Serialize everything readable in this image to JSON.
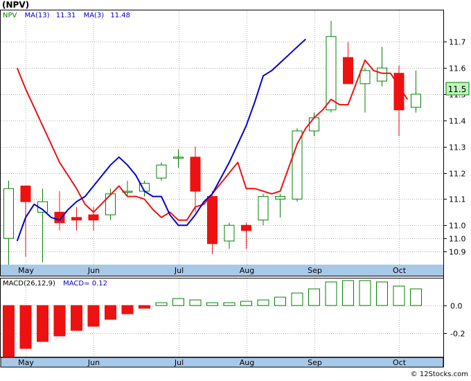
{
  "chart_data": [
    {
      "type": "candlestick",
      "symbol_label": "(NPV)",
      "legend": [
        {
          "text": "NPV",
          "color": "#008000"
        },
        {
          "text": "MA(13)",
          "color": "#0000cc"
        },
        {
          "text": "11.31",
          "color": "#0000cc"
        },
        {
          "text": "MA(3)",
          "color": "#0000cc"
        },
        {
          "text": "11.48",
          "color": "#0000cc"
        }
      ],
      "current_price_label": "11.5",
      "ylim": [
        10.85,
        11.78
      ],
      "yticks": [
        "11.7",
        "11.6",
        "11.5",
        "11.4",
        "11.3",
        "11.2",
        "11.1",
        "11.0",
        "11.0",
        "10.9"
      ],
      "ytick_values": [
        11.7,
        11.6,
        11.5,
        11.4,
        11.3,
        11.2,
        11.1,
        11.0,
        10.95,
        10.9
      ],
      "xticks": [
        "May",
        "Jun",
        "Jul",
        "Aug",
        "Sep",
        "Oct"
      ],
      "xtick_index": [
        1,
        5,
        10,
        14,
        18,
        23
      ],
      "candles": [
        {
          "o": 10.95,
          "h": 11.17,
          "l": 10.85,
          "c": 11.14
        },
        {
          "o": 11.15,
          "h": 11.15,
          "l": 10.88,
          "c": 11.09
        },
        {
          "o": 11.05,
          "h": 11.14,
          "l": 10.86,
          "c": 11.09
        },
        {
          "o": 11.05,
          "h": 11.13,
          "l": 10.98,
          "c": 11.01
        },
        {
          "o": 11.03,
          "h": 11.07,
          "l": 10.98,
          "c": 11.02
        },
        {
          "o": 11.04,
          "h": 11.07,
          "l": 10.98,
          "c": 11.02
        },
        {
          "o": 11.04,
          "h": 11.14,
          "l": 11.02,
          "c": 11.12
        },
        {
          "o": 11.13,
          "h": 11.17,
          "l": 11.11,
          "c": 11.13
        },
        {
          "o": 11.13,
          "h": 11.17,
          "l": 11.11,
          "c": 11.16
        },
        {
          "o": 11.18,
          "h": 11.24,
          "l": 11.17,
          "c": 11.23
        },
        {
          "o": 11.26,
          "h": 11.29,
          "l": 11.22,
          "c": 11.26
        },
        {
          "o": 11.26,
          "h": 11.3,
          "l": 11.05,
          "c": 11.13
        },
        {
          "o": 11.11,
          "h": 11.13,
          "l": 10.89,
          "c": 10.93
        },
        {
          "o": 10.94,
          "h": 11.01,
          "l": 10.91,
          "c": 11.0
        },
        {
          "o": 11.0,
          "h": 11.01,
          "l": 10.91,
          "c": 10.98
        },
        {
          "o": 11.02,
          "h": 11.12,
          "l": 11.0,
          "c": 11.11
        },
        {
          "o": 11.1,
          "h": 11.12,
          "l": 11.03,
          "c": 11.11
        },
        {
          "o": 11.1,
          "h": 11.37,
          "l": 11.09,
          "c": 11.36
        },
        {
          "o": 11.36,
          "h": 11.43,
          "l": 11.34,
          "c": 11.41
        },
        {
          "o": 11.44,
          "h": 11.78,
          "l": 11.43,
          "c": 11.72
        },
        {
          "o": 11.64,
          "h": 11.7,
          "l": 11.54,
          "c": 11.54
        },
        {
          "o": 11.54,
          "h": 11.6,
          "l": 11.43,
          "c": 11.59
        },
        {
          "o": 11.55,
          "h": 11.68,
          "l": 11.53,
          "c": 11.6
        },
        {
          "o": 11.58,
          "h": 11.61,
          "l": 11.34,
          "c": 11.44
        },
        {
          "o": 11.45,
          "h": 11.59,
          "l": 11.43,
          "c": 11.5
        }
      ],
      "series": [
        {
          "name": "MA(3)",
          "color": "#ee1111",
          "values": [
            null,
            11.6,
            11.52,
            11.45,
            11.38,
            11.31,
            11.24,
            11.19,
            11.14,
            11.08,
            11.05,
            null,
            null,
            11.15,
            11.11,
            11.11,
            11.1,
            11.06,
            11.03,
            11.05,
            11.02,
            11.02,
            11.07,
            11.08,
            11.12,
            null,
            null,
            11.24,
            11.14,
            11.14,
            11.13,
            11.12,
            11.13,
            11.22,
            11.31,
            11.37,
            11.41,
            11.44,
            11.48,
            11.46,
            11.46,
            null,
            11.63,
            11.59,
            11.58,
            11.58,
            11.53,
            11.48
          ]
        },
        {
          "name": "MA(13)",
          "color": "#0000cc",
          "values": [
            null,
            10.94,
            11.03,
            11.08,
            11.06,
            11.03,
            11.02,
            11.06,
            11.09,
            11.11,
            11.15,
            11.19,
            11.23,
            11.26,
            11.23,
            11.19,
            11.13,
            11.11,
            11.11,
            11.04,
            11.0,
            11.0,
            11.04,
            11.09,
            11.12,
            11.18,
            11.24,
            11.31,
            11.38,
            11.47,
            11.57,
            11.59,
            11.62,
            11.65,
            11.68,
            11.71,
            null,
            null,
            null,
            null,
            null,
            null,
            null,
            null,
            null,
            null,
            null,
            null
          ]
        }
      ]
    },
    {
      "type": "bar",
      "legend": [
        {
          "text": "MACD(26,12,9)",
          "color": "#000000"
        },
        {
          "text": "MACD=",
          "color": "#0000cc"
        },
        {
          "text": "0.12",
          "color": "#0000cc"
        }
      ],
      "ylim": [
        -0.37,
        0.19
      ],
      "yticks": [
        "0.0",
        "-0.2"
      ],
      "ytick_values": [
        0.0,
        -0.2
      ],
      "xticks": [
        "May",
        "Jun",
        "Jul",
        "Aug",
        "Sep",
        "Oct"
      ],
      "xtick_index": [
        1,
        5,
        10,
        14,
        18,
        23
      ],
      "values": [
        -0.37,
        -0.31,
        -0.26,
        -0.22,
        -0.18,
        -0.15,
        -0.1,
        -0.06,
        -0.02,
        0.02,
        0.05,
        0.04,
        0.02,
        0.02,
        0.03,
        0.04,
        0.06,
        0.09,
        0.12,
        0.17,
        0.18,
        0.18,
        0.17,
        0.14,
        0.12
      ]
    }
  ],
  "footer": {
    "copyright": "© 12Stocks.com"
  },
  "colors": {
    "up": "#008000",
    "down": "#ee1111",
    "axis_band": "#a8c8e8",
    "price_box": "#bff5bf"
  }
}
